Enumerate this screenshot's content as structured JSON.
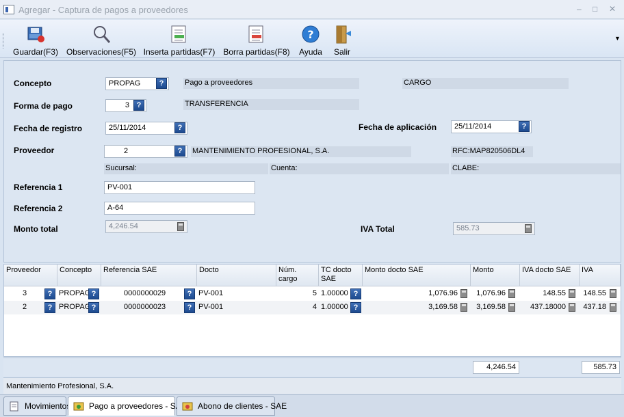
{
  "window": {
    "title": "Agregar - Captura de pagos a proveedores"
  },
  "toolbar": [
    {
      "label": "Guardar(F3)",
      "icon": "save-icon"
    },
    {
      "label": "Observaciones(F5)",
      "icon": "magnifier-icon"
    },
    {
      "label": "Inserta partidas(F7)",
      "icon": "insert-rows-icon"
    },
    {
      "label": "Borra partidas(F8)",
      "icon": "delete-rows-icon"
    },
    {
      "label": "Ayuda",
      "icon": "help-icon"
    },
    {
      "label": "Salir",
      "icon": "exit-door-icon"
    }
  ],
  "form": {
    "concepto_label": "Concepto",
    "concepto_value": "PROPAG",
    "concepto_desc": "Pago a proveedores",
    "concepto_type": "CARGO",
    "forma_label": "Forma de pago",
    "forma_value": "3",
    "forma_desc": "TRANSFERENCIA",
    "fecha_registro_label": "Fecha de registro",
    "fecha_registro_value": "25/11/2014",
    "fecha_aplicacion_label": "Fecha de aplicación",
    "fecha_aplicacion_value": "25/11/2014",
    "proveedor_label": "Proveedor",
    "proveedor_value": "2",
    "proveedor_name": "MANTENIMIENTO PROFESIONAL, S.A.",
    "proveedor_rfc": "RFC:MAP820506DL4",
    "sucursal_label": "Sucursal:",
    "cuenta_label": "Cuenta:",
    "clabe_label": "CLABE:",
    "referencia1_label": "Referencia 1",
    "referencia1_value": "PV-001",
    "referencia2_label": "Referencia 2",
    "referencia2_value": "A-64",
    "monto_total_label": "Monto total",
    "monto_total_value": "4,246.54",
    "iva_total_label": "IVA Total",
    "iva_total_value": "585.73"
  },
  "grid": {
    "columns": [
      "Proveedor",
      "Concepto",
      "Referencia SAE",
      "Docto",
      "Núm. cargo",
      "TC docto SAE",
      "Monto docto SAE",
      "Monto",
      "IVA docto SAE",
      "IVA"
    ],
    "rows": [
      {
        "proveedor": "3",
        "concepto": "PROPAG",
        "referencia": "0000000029",
        "docto": "PV-001",
        "num_cargo": "5",
        "tc": "1.00000",
        "monto_docto": "1,076.96",
        "monto": "1,076.96",
        "iva_docto": "148.55",
        "iva": "148.55"
      },
      {
        "proveedor": "2",
        "concepto": "PROPAG",
        "referencia": "0000000023",
        "docto": "PV-001",
        "num_cargo": "4",
        "tc": "1.00000",
        "monto_docto": "3,169.58",
        "monto": "3,169.58",
        "iva_docto": "437.18000",
        "iva": "437.18"
      }
    ],
    "total_monto": "4,246.54",
    "total_iva": "585.73"
  },
  "status": {
    "text": "Mantenimiento Profesional, S.A."
  },
  "tabs": [
    {
      "label": "Movimientos",
      "active": false
    },
    {
      "label": "Pago a proveedores - SAE",
      "active": true
    },
    {
      "label": "Abono de clientes - SAE",
      "active": false
    }
  ]
}
